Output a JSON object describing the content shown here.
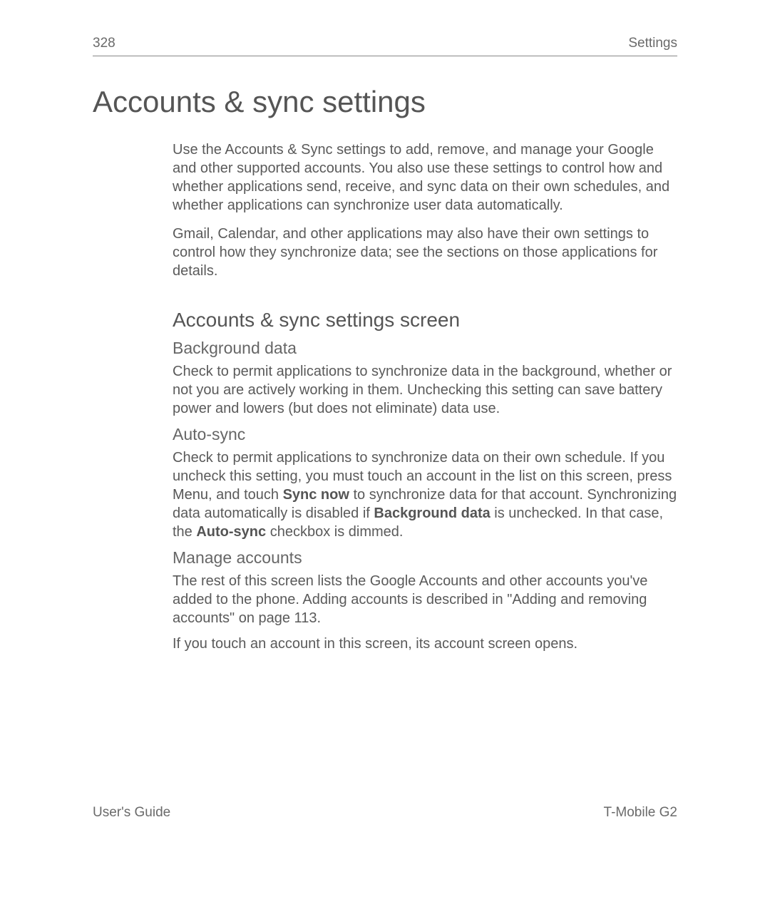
{
  "header": {
    "page_number": "328",
    "chapter": "Settings"
  },
  "main_title": "Accounts & sync settings",
  "intro": {
    "para1": "Use the Accounts & Sync settings to add, remove, and manage your Google and other supported accounts. You also use these settings to control how and whether applications send, receive, and sync data on their own schedules, and whether applications can synchronize user data automatically.",
    "para2": "Gmail, Calendar, and other applications may also have their own settings to control how they synchronize data; see the sections on those applications for details."
  },
  "section": {
    "title": "Accounts & sync settings screen",
    "background_data": {
      "heading": "Background data",
      "text": "Check to permit applications to synchronize data in the background, whether or not you are actively working in them. Unchecking this setting can save battery power and lowers (but does not eliminate) data use."
    },
    "auto_sync": {
      "heading": "Auto-sync",
      "text_pre": "Check to permit applications to synchronize data on their own schedule. If you uncheck this setting, you must touch an account in the list on this screen, press ",
      "menu_label": "Menu",
      "text_mid1": ", and touch ",
      "sync_now_label": "Sync now",
      "text_mid2": " to synchronize data for that account. Synchronizing data automatically is disabled if ",
      "background_data_label": "Background data",
      "text_mid3": " is unchecked. In that case, the ",
      "auto_sync_label": "Auto-sync",
      "text_end": " checkbox is dimmed."
    },
    "manage_accounts": {
      "heading": "Manage accounts",
      "para1": "The rest of this screen lists the Google Accounts and other accounts you've added to the phone. Adding accounts is described in \"Adding and removing accounts\" on page 113.",
      "para2": "If you touch an account in this screen, its account screen opens."
    }
  },
  "footer": {
    "left": "User's Guide",
    "right": "T-Mobile G2"
  }
}
